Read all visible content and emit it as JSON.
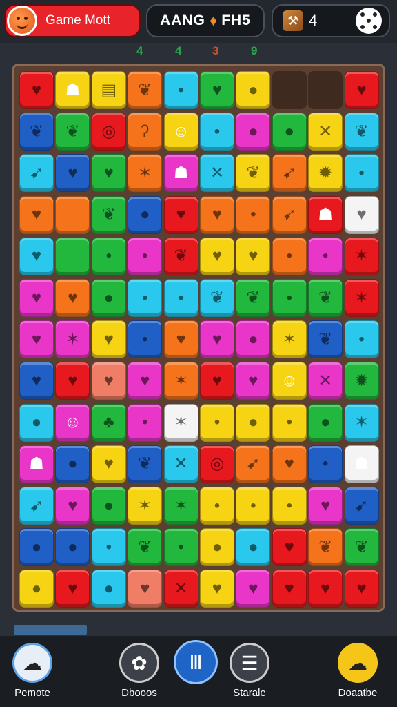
{
  "header": {
    "player_name": "Game Mott",
    "title_left": "AANG",
    "title_right": "FH5",
    "score": "4"
  },
  "counters": [
    {
      "text": "4",
      "color": "#2aa84a"
    },
    {
      "text": "4",
      "color": "#2aa84a"
    },
    {
      "text": "3",
      "color": "#c8552a"
    },
    {
      "text": "9",
      "color": "#2aa84a"
    }
  ],
  "colors": {
    "R": "#e8191e",
    "Y": "#f6d313",
    "O": "#f5731b",
    "C": "#29c8ec",
    "G": "#22b83e",
    "M": "#ea36c8",
    "B": "#1f5fc6",
    "W": "#f4f4f4",
    "S": "#f07d66",
    "P": "#f04fa2",
    "E": "#3f2a1f"
  },
  "board": [
    [
      "R:heart",
      "Y:ghost",
      "Y:flag",
      "O:leaf",
      "C:dot",
      "G:heart",
      "Y:drop",
      "E:",
      "E:",
      "R:heart"
    ],
    [
      "B:leaf",
      "G:leaf",
      "R:swirl",
      "O:ear",
      "Y:face",
      "C:dot",
      "M:drop",
      "G:drop",
      "Y:cross",
      "C:leaf"
    ],
    [
      "C:arrow",
      "B:heart",
      "G:heart",
      "O:star",
      "M:ghost",
      "C:cross",
      "Y:leaf",
      "O:arrow",
      "Y:sun",
      "C:dot"
    ],
    [
      "O:heart",
      "O:",
      "G:leaf",
      "B:drop",
      "R:heart",
      "O:heart",
      "O:dot",
      "O:arrow",
      "R:ghost",
      "W:heart"
    ],
    [
      "C:heart",
      "G:",
      "G:dot",
      "M:dot",
      "R:leaf",
      "Y:heart",
      "Y:heart",
      "O:dot",
      "M:dot",
      "R:star"
    ],
    [
      "M:heart",
      "O:heart",
      "G:drop",
      "C:dot",
      "C:dot",
      "C:leaf",
      "G:leaf",
      "G:dot",
      "G:leaf",
      "R:star"
    ],
    [
      "M:heart",
      "M:star",
      "Y:heart",
      "B:dot",
      "O:heart",
      "M:heart",
      "M:drop",
      "Y:star",
      "B:leaf",
      "C:dot"
    ],
    [
      "B:heart",
      "R:heart",
      "S:heart",
      "M:heart",
      "O:star",
      "R:heart",
      "M:heart",
      "Y:face",
      "M:cross",
      "G:sun"
    ],
    [
      "C:drop",
      "M:face",
      "G:tree",
      "M:dot",
      "W:star",
      "Y:dot",
      "Y:drop",
      "Y:dot",
      "G:drop",
      "C:star"
    ],
    [
      "M:ghost",
      "B:drop",
      "Y:heart",
      "B:leaf",
      "C:cross",
      "R:swirl",
      "O:arrow",
      "O:heart",
      "B:dot",
      "W:ghost"
    ],
    [
      "C:arrow",
      "M:heart",
      "G:drop",
      "Y:star",
      "G:star",
      "Y:dot",
      "Y:dot",
      "Y:dot",
      "M:heart",
      "B:arrow"
    ],
    [
      "B:drop",
      "B:drop",
      "C:dot",
      "G:leaf",
      "G:dot",
      "Y:drop",
      "C:drop",
      "R:heart",
      "O:leaf",
      "G:leaf"
    ],
    [
      "Y:drop",
      "R:heart",
      "C:drop",
      "S:heart",
      "R:cross",
      "Y:heart",
      "M:heart",
      "R:heart",
      "R:heart",
      "R:heart"
    ]
  ],
  "icons": {
    "heart": "♥",
    "leaf": "❦",
    "drop": "●",
    "dot": "•",
    "cross": "✕",
    "star": "✶",
    "ghost": "☗",
    "flag": "▤",
    "swirl": "◎",
    "ear": "ʔ",
    "face": "☺",
    "sun": "✹",
    "arrow": "➹",
    "tree": "♣"
  },
  "nav": [
    {
      "label": "Pemote",
      "ring": "#5aa3e8",
      "bg": "#e8eef6",
      "icon": "speech-bubble-icon",
      "glyph": "☁"
    },
    {
      "label": "Dbooos",
      "ring": "#cccccc",
      "bg": "#3c4048",
      "icon": "gear-icon",
      "glyph": "✿"
    },
    {
      "label": "",
      "ring": "#8fc2ff",
      "bg": "#1f65c8",
      "icon": "pause-icon",
      "glyph": "Ⅲ"
    },
    {
      "label": "Starale",
      "ring": "#cccccc",
      "bg": "#3c4048",
      "icon": "list-icon",
      "glyph": "☰"
    },
    {
      "label": "Doaatbe",
      "ring": "#f2c522",
      "bg": "#f5c518",
      "icon": "chat-icon",
      "glyph": "☁"
    }
  ]
}
